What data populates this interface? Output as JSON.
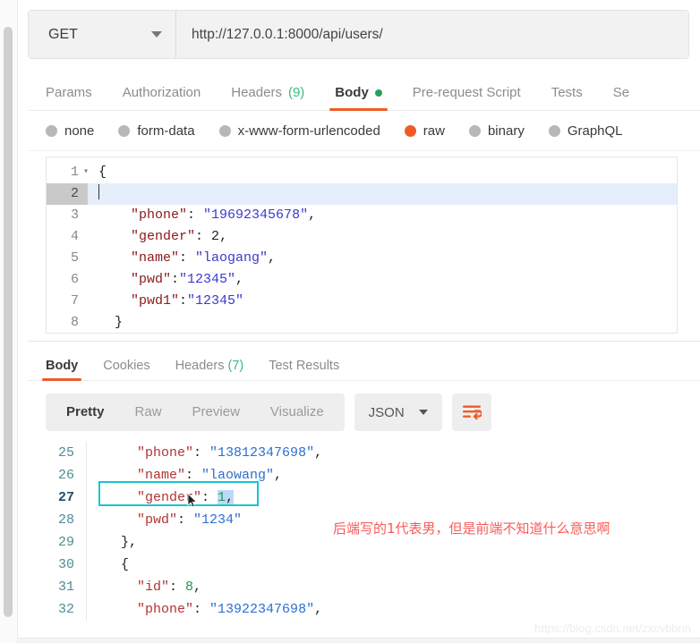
{
  "request": {
    "method": "GET",
    "url": "http://127.0.0.1:8000/api/users/",
    "tabs": [
      {
        "label": "Params",
        "active": false
      },
      {
        "label": "Authorization",
        "active": false
      },
      {
        "label": "Headers",
        "count": "(9)",
        "active": false
      },
      {
        "label": "Body",
        "active": true,
        "dot": true
      },
      {
        "label": "Pre-request Script",
        "active": false
      },
      {
        "label": "Tests",
        "active": false
      },
      {
        "label": "Se",
        "active": false
      }
    ],
    "body_types": [
      {
        "label": "none",
        "selected": false
      },
      {
        "label": "form-data",
        "selected": false
      },
      {
        "label": "x-www-form-urlencoded",
        "selected": false
      },
      {
        "label": "raw",
        "selected": true
      },
      {
        "label": "binary",
        "selected": false
      },
      {
        "label": "GraphQL",
        "selected": false
      }
    ],
    "editor": {
      "line_numbers": [
        "1",
        "2",
        "3",
        "4",
        "5",
        "6",
        "7",
        "8"
      ],
      "active_line": 2,
      "fold_line": 1,
      "lines": [
        {
          "n": 1,
          "tokens": [
            {
              "t": "punct",
              "v": "{"
            }
          ]
        },
        {
          "n": 2,
          "tokens": []
        },
        {
          "n": 3,
          "tokens": [
            {
              "t": "key",
              "v": "    \"phone\""
            },
            {
              "t": "punct",
              "v": ": "
            },
            {
              "t": "str",
              "v": "\"19692345678\""
            },
            {
              "t": "punct",
              "v": ","
            }
          ]
        },
        {
          "n": 4,
          "tokens": [
            {
              "t": "key",
              "v": "    \"gender\""
            },
            {
              "t": "punct",
              "v": ": "
            },
            {
              "t": "num",
              "v": "2"
            },
            {
              "t": "punct",
              "v": ","
            }
          ]
        },
        {
          "n": 5,
          "tokens": [
            {
              "t": "key",
              "v": "    \"name\""
            },
            {
              "t": "punct",
              "v": ": "
            },
            {
              "t": "str",
              "v": "\"laogang\""
            },
            {
              "t": "punct",
              "v": ","
            }
          ]
        },
        {
          "n": 6,
          "tokens": [
            {
              "t": "key",
              "v": "    \"pwd\""
            },
            {
              "t": "punct",
              "v": ":"
            },
            {
              "t": "str",
              "v": "\"12345\""
            },
            {
              "t": "punct",
              "v": ","
            }
          ]
        },
        {
          "n": 7,
          "tokens": [
            {
              "t": "key",
              "v": "    \"pwd1\""
            },
            {
              "t": "punct",
              "v": ":"
            },
            {
              "t": "str",
              "v": "\"12345\""
            }
          ]
        },
        {
          "n": 8,
          "tokens": [
            {
              "t": "punct",
              "v": "  }"
            }
          ]
        }
      ]
    }
  },
  "response": {
    "tabs": [
      {
        "label": "Body",
        "active": true
      },
      {
        "label": "Cookies",
        "active": false
      },
      {
        "label": "Headers",
        "count": "(7)",
        "active": false
      },
      {
        "label": "Test Results",
        "active": false
      }
    ],
    "view_modes": [
      {
        "label": "Pretty",
        "active": true
      },
      {
        "label": "Raw",
        "active": false
      },
      {
        "label": "Preview",
        "active": false
      },
      {
        "label": "Visualize",
        "active": false
      }
    ],
    "format": "JSON",
    "wrap_icon": "wrap-text-icon",
    "editor": {
      "line_numbers": [
        "25",
        "26",
        "27",
        "28",
        "29",
        "30",
        "31",
        "32"
      ],
      "active_line": 27,
      "lines": [
        {
          "n": 25,
          "tokens": [
            {
              "t": "key",
              "v": "    \"phone\""
            },
            {
              "t": "punct",
              "v": ": "
            },
            {
              "t": "str",
              "v": "\"13812347698\""
            },
            {
              "t": "punct",
              "v": ","
            }
          ]
        },
        {
          "n": 26,
          "tokens": [
            {
              "t": "key",
              "v": "    \"name\""
            },
            {
              "t": "punct",
              "v": ": "
            },
            {
              "t": "str",
              "v": "\"laowang\""
            },
            {
              "t": "punct",
              "v": ","
            }
          ]
        },
        {
          "n": 27,
          "tokens": [
            {
              "t": "key",
              "v": "    \"gender\""
            },
            {
              "t": "punct",
              "v": ": "
            },
            {
              "t": "num-sel",
              "v": "1"
            },
            {
              "t": "punct-sel",
              "v": ","
            }
          ]
        },
        {
          "n": 28,
          "tokens": [
            {
              "t": "key",
              "v": "    \"pwd\""
            },
            {
              "t": "punct",
              "v": ": "
            },
            {
              "t": "str",
              "v": "\"1234\""
            }
          ]
        },
        {
          "n": 29,
          "tokens": [
            {
              "t": "punct",
              "v": "  },"
            }
          ]
        },
        {
          "n": 30,
          "tokens": [
            {
              "t": "punct",
              "v": "  {"
            }
          ]
        },
        {
          "n": 31,
          "tokens": [
            {
              "t": "key",
              "v": "    \"id\""
            },
            {
              "t": "punct",
              "v": ": "
            },
            {
              "t": "num",
              "v": "8"
            },
            {
              "t": "punct",
              "v": ","
            }
          ]
        },
        {
          "n": 32,
          "tokens": [
            {
              "t": "key",
              "v": "    \"phone\""
            },
            {
              "t": "punct",
              "v": ": "
            },
            {
              "t": "str",
              "v": "\"13922347698\""
            },
            {
              "t": "punct",
              "v": ","
            }
          ]
        }
      ]
    }
  },
  "annotation": {
    "text": "后端写的1代表男，但是前端不知道什么意思啊",
    "color": "#fb5a5a",
    "highlight_box_color": "#19c4d4"
  },
  "watermark": "https://blog.csdn.net/zxcvbbnn"
}
